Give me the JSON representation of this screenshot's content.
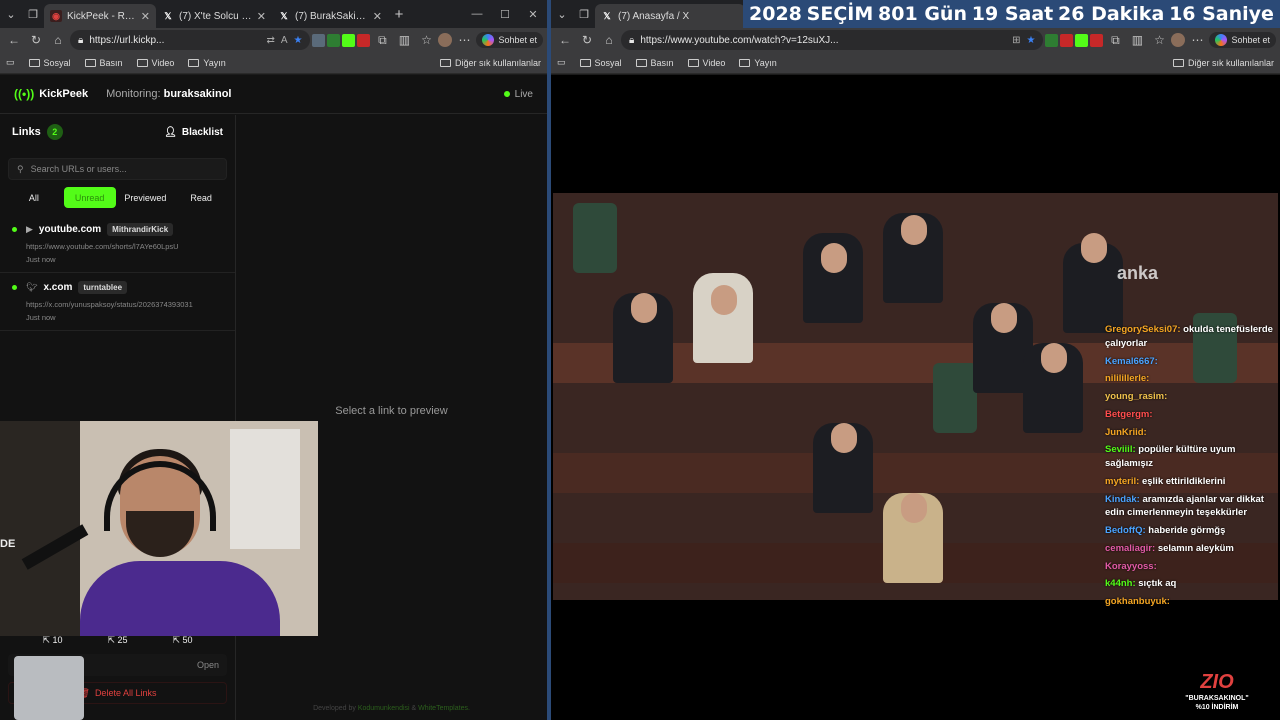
{
  "left_browser": {
    "tabs": [
      {
        "title": "KickPeek - Real-time L",
        "active": true
      },
      {
        "title": "(7) X'te Solcu Gazete: ",
        "active": false
      },
      {
        "title": "(7) BurakSakinOl (@bu",
        "active": false
      }
    ],
    "new_tab": "+",
    "url": "https://url.kickp...",
    "copilot_label": "Sohbet et",
    "favorites": [
      "Sosyal",
      "Basın",
      "Video",
      "Yayın"
    ],
    "favorites_other": "Diğer sık kullanılanlar"
  },
  "kickpeek": {
    "brand": "KickPeek",
    "monitoring_label": "Monitoring:",
    "monitoring_user": "buraksakinol",
    "live_label": "Live",
    "links_label": "Links",
    "links_count": "2",
    "blacklist_label": "Blacklist",
    "search_placeholder": "Search URLs or users...",
    "filters": [
      "All",
      "Unread",
      "Previewed",
      "Read"
    ],
    "links": [
      {
        "site": "youtube.com",
        "user": "MithrandirKick",
        "url": "https://www.youtube.com/shorts/l7AYe60LpsU",
        "time": "Just now"
      },
      {
        "site": "x.com",
        "user": "turntablee",
        "url": "https://x.com/yunuspaksoy/status/2026374393031",
        "time": "Just now"
      }
    ],
    "preview_message": "Select a link to preview",
    "stats": [
      "10",
      "25",
      "50"
    ],
    "open_label": "Open",
    "delete_label": "Delete All Links",
    "dev_prefix": "Developed by",
    "dev_name1": "Kodumunkendisi",
    "dev_and": "&",
    "dev_name2": "WhiteTemplates."
  },
  "webcam": {
    "label": "DE"
  },
  "right_browser": {
    "tab_title": "(7) Anasayfa / X",
    "url": "https://www.youtube.com/watch?v=12suXJ...",
    "copilot_label": "Sohbet et",
    "favorites": [
      "Sosyal",
      "Basın",
      "Video",
      "Yayın"
    ],
    "favorites_other": "Diğer sık kullanılanlar"
  },
  "countdown": [
    "2028",
    "SEÇİM",
    "801 Gün",
    "19 Saat",
    "26 Dakika",
    "16 Saniye"
  ],
  "video": {
    "watermark": "anka",
    "chat": [
      {
        "user": "GregorySeksi07:",
        "text": "okulda tenefüslerde çalıyorlar",
        "cls": "u1"
      },
      {
        "user": "Kemal6667:",
        "text": "",
        "cls": "u2"
      },
      {
        "user": "nililillerle:",
        "text": "",
        "cls": "u1"
      },
      {
        "user": "young_rasim:",
        "text": "",
        "cls": "u6"
      },
      {
        "user": "Betgergm:",
        "text": "",
        "cls": "u3"
      },
      {
        "user": "JunKriid:",
        "text": "",
        "cls": "u1"
      },
      {
        "user": "Seviiil:",
        "text": "popüler kültüre uyum sağlamışız",
        "cls": "u4"
      },
      {
        "user": "myteril:",
        "text": "eşlik ettirildiklerini",
        "cls": "u1"
      },
      {
        "user": "Kindak:",
        "text": "aramızda ajanlar var dikkat edin cimerlenmeyin teşekkürler",
        "cls": "u2"
      },
      {
        "user": "BedoffQ:",
        "text": "haberide görmğş",
        "cls": "u2"
      },
      {
        "user": "cemaliagir:",
        "text": "selamın aleyküm",
        "cls": "u5"
      },
      {
        "user": "Korayyoss:",
        "text": "",
        "cls": "u5"
      },
      {
        "user": "k44nh:",
        "text": "sıçtık aq",
        "cls": "u4"
      },
      {
        "user": "gokhanbuyuk:",
        "text": "",
        "cls": "u1"
      }
    ],
    "promo_logo": "ZIO",
    "promo_line1": "\"BURAKSAKINOL\"",
    "promo_line2": "%10 İNDİRİM"
  }
}
